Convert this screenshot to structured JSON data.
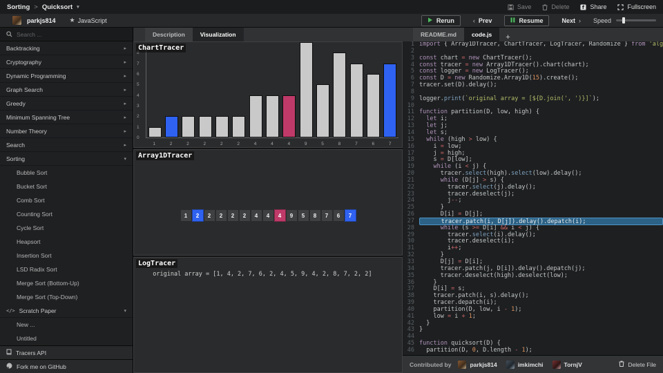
{
  "nav": {
    "breadcrumb": [
      "Sorting",
      "Quicksort"
    ],
    "actions": [
      {
        "label": "Save",
        "icon": "save-icon",
        "enabled": false
      },
      {
        "label": "Delete",
        "icon": "trash-icon",
        "enabled": false
      },
      {
        "label": "Share",
        "icon": "share-icon",
        "enabled": true
      },
      {
        "label": "Fullscreen",
        "icon": "fullscreen-icon",
        "enabled": true
      }
    ]
  },
  "toolbar": {
    "user": "parkjs814",
    "language": "JavaScript",
    "rerun_label": "Rerun",
    "prev_label": "Prev",
    "resume_label": "Resume",
    "next_label": "Next",
    "speed_label": "Speed",
    "speed_value_pct": 15
  },
  "sidebar": {
    "search_placeholder": "Search ...",
    "categories": [
      {
        "label": "Backtracking",
        "expanded": false
      },
      {
        "label": "Cryptography",
        "expanded": false
      },
      {
        "label": "Dynamic Programming",
        "expanded": false
      },
      {
        "label": "Graph Search",
        "expanded": false
      },
      {
        "label": "Greedy",
        "expanded": false
      },
      {
        "label": "Minimum Spanning Tree",
        "expanded": false
      },
      {
        "label": "Number Theory",
        "expanded": false
      },
      {
        "label": "Search",
        "expanded": false
      },
      {
        "label": "Sorting",
        "expanded": true
      }
    ],
    "sorting_children": [
      "Bubble Sort",
      "Bucket Sort",
      "Comb Sort",
      "Counting Sort",
      "Cycle Sort",
      "Heapsort",
      "Insertion Sort",
      "LSD Radix Sort",
      "Merge Sort (Bottom-Up)",
      "Merge Sort (Top-Down)"
    ],
    "scratch_paper": {
      "label": "Scratch Paper",
      "expanded": true,
      "children": [
        "New ...",
        "Untitled"
      ]
    },
    "footer_links": [
      {
        "label": "Tracers API",
        "icon": "book-icon"
      },
      {
        "label": "Fork me on GitHub",
        "icon": "github-icon"
      }
    ]
  },
  "viz_tabs": [
    {
      "label": "Description",
      "active": false
    },
    {
      "label": "Visualization",
      "active": true
    }
  ],
  "editor_tabs": [
    {
      "label": "README.md",
      "active": false
    },
    {
      "label": "code.js",
      "active": true
    }
  ],
  "editor_new_tab_label": "+",
  "chart_data": {
    "type": "bar",
    "title": "ChartTracer",
    "categories": [
      "1",
      "2",
      "2",
      "2",
      "2",
      "2",
      "4",
      "4",
      "4",
      "9",
      "5",
      "8",
      "7",
      "6",
      "7"
    ],
    "values": [
      1,
      2,
      2,
      2,
      2,
      2,
      4,
      4,
      4,
      9,
      5,
      8,
      7,
      6,
      7
    ],
    "bar_states": [
      "normal",
      "selected",
      "normal",
      "normal",
      "normal",
      "normal",
      "normal",
      "normal",
      "patched",
      "normal",
      "normal",
      "normal",
      "normal",
      "normal",
      "selected"
    ],
    "yticks": [
      0,
      1,
      2,
      3,
      4,
      5,
      6,
      7,
      8
    ],
    "ylim": [
      0,
      9
    ],
    "xlabel": "",
    "ylabel": "",
    "grid": false,
    "legend": false
  },
  "array_tracer": {
    "title": "Array1DTracer",
    "values": [
      1,
      2,
      2,
      2,
      2,
      2,
      4,
      4,
      4,
      9,
      5,
      8,
      7,
      6,
      7
    ],
    "states": [
      "normal",
      "selected",
      "normal",
      "normal",
      "normal",
      "normal",
      "normal",
      "normal",
      "patched",
      "normal",
      "normal",
      "normal",
      "normal",
      "normal",
      "selected"
    ]
  },
  "log_tracer": {
    "title": "LogTracer",
    "lines": [
      "  original array = [1, 4, 2, 7, 6, 2, 4, 5, 9, 4, 2, 8, 7, 2, 2]"
    ]
  },
  "code": {
    "active_line": 27,
    "lines": [
      "import { Array1DTracer, ChartTracer, LogTracer, Randomize } from 'algorithm-visualizer';",
      "",
      "const chart = new ChartTracer();",
      "const tracer = new Array1DTracer().chart(chart);",
      "const logger = new LogTracer();",
      "const D = new Randomize.Array1D(15).create();",
      "tracer.set(D).delay();",
      "",
      "logger.print(`original array = [${D.join(', ')}]`);",
      "",
      "function partition(D, low, high) {",
      "  let i;",
      "  let j;",
      "  let s;",
      "  while (high > low) {",
      "    i = low;",
      "    j = high;",
      "    s = D[low];",
      "    while (i < j) {",
      "      tracer.select(high).select(low).delay();",
      "      while (D[j] > s) {",
      "        tracer.select(j).delay();",
      "        tracer.deselect(j);",
      "        j--;",
      "      }",
      "      D[i] = D[j];",
      "      tracer.patch(i, D[j]).delay().depatch(i);",
      "      while (s >= D[i] && i < j) {",
      "        tracer.select(i).delay();",
      "        tracer.deselect(i);",
      "        i++;",
      "      }",
      "      D[j] = D[i];",
      "      tracer.patch(j, D[i]).delay().depatch(j);",
      "      tracer.deselect(high).deselect(low);",
      "    }",
      "    D[i] = s;",
      "    tracer.patch(i, s).delay();",
      "    tracer.depatch(i);",
      "    partition(D, low, i - 1);",
      "    low = i + 1;",
      "  }",
      "}",
      "",
      "function quicksort(D) {",
      "  partition(D, 0, D.length - 1);"
    ]
  },
  "footer": {
    "contributed_by_label": "Contributed by",
    "contributors": [
      "parkjs814",
      "imkimchi",
      "TornjV"
    ],
    "delete_file_label": "Delete File"
  },
  "colors": {
    "bar_default": "#c9c9c9",
    "selected": "#2f62f1",
    "patched": "#bf3a68",
    "accent_green": "#4cbb5f",
    "active_line_bg": "#2c6286"
  }
}
